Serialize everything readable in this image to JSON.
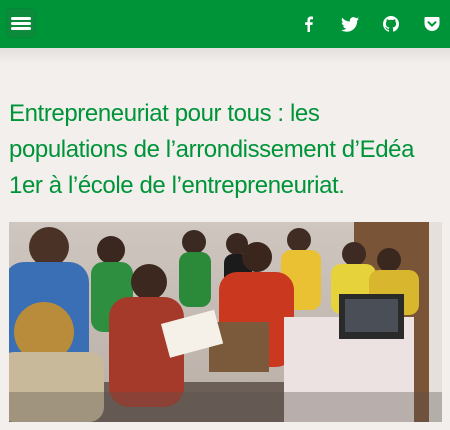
{
  "header": {
    "menu_icon": "hamburger-menu-icon",
    "background_color": "#009439",
    "social_icons": [
      "facebook-icon",
      "twitter-icon",
      "github-icon",
      "pocket-icon"
    ]
  },
  "article": {
    "title": "Entrepreneuriat pour tous : les populations de l’arrondissement d’Edéa 1er à l’école de l’entrepreneuriat.",
    "title_color": "#009439"
  }
}
